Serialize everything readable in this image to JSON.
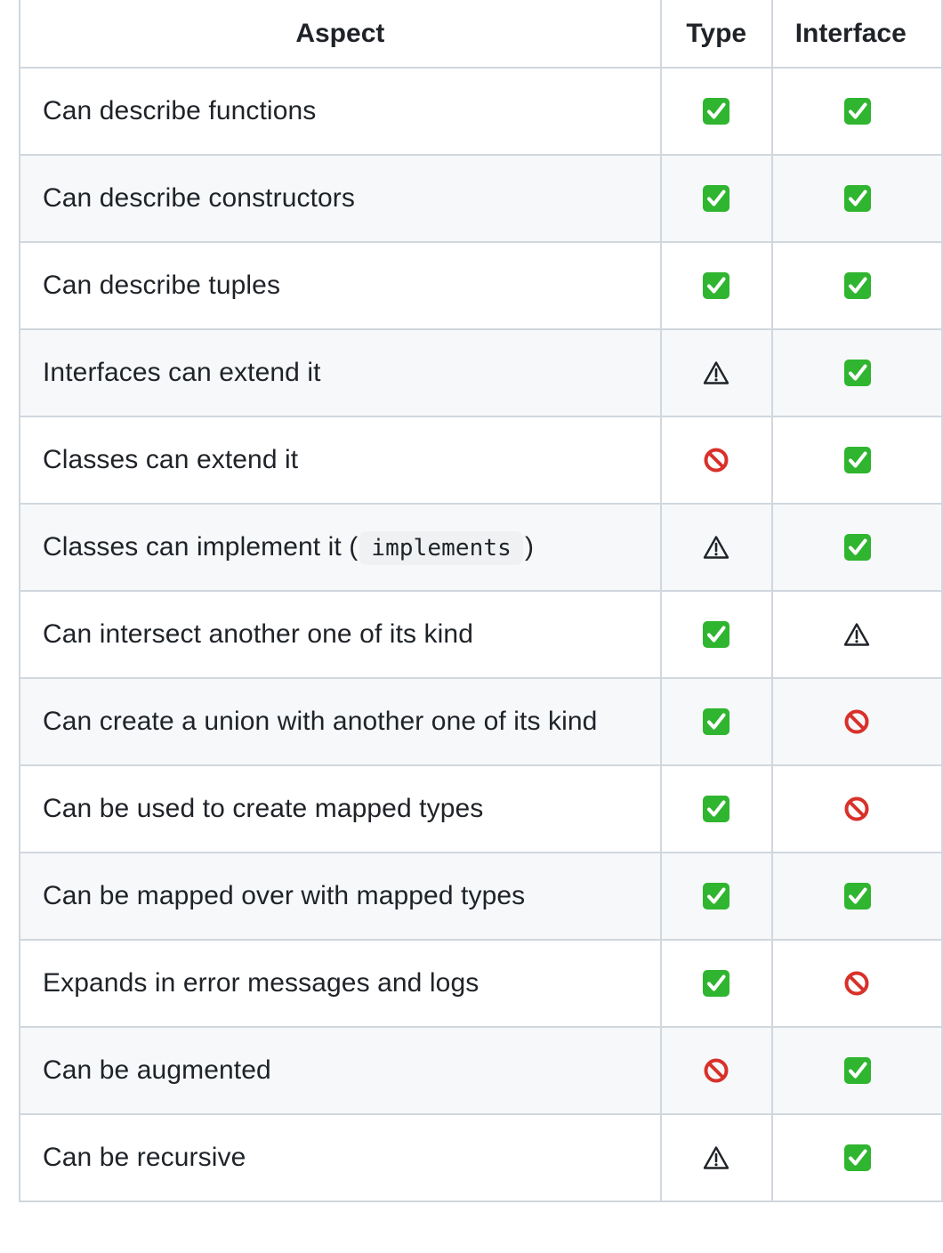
{
  "table": {
    "headers": [
      "Aspect",
      "Type",
      "Interface"
    ],
    "rows": [
      {
        "aspect": "Can describe functions",
        "type": "check",
        "interface": "check"
      },
      {
        "aspect": "Can describe constructors",
        "type": "check",
        "interface": "check"
      },
      {
        "aspect": "Can describe tuples",
        "type": "check",
        "interface": "check"
      },
      {
        "aspect": "Interfaces can extend it",
        "type": "warning",
        "interface": "check"
      },
      {
        "aspect": "Classes can extend it",
        "type": "no-entry",
        "interface": "check"
      },
      {
        "aspect_prefix": "Classes can implement it (",
        "aspect_code": "implements",
        "aspect_suffix": ")",
        "type": "warning",
        "interface": "check"
      },
      {
        "aspect": "Can intersect another one of its kind",
        "type": "check",
        "interface": "warning"
      },
      {
        "aspect": "Can create a union with another one of its kind",
        "type": "check",
        "interface": "no-entry"
      },
      {
        "aspect": "Can be used to create mapped types",
        "type": "check",
        "interface": "no-entry"
      },
      {
        "aspect": "Can be mapped over with mapped types",
        "type": "check",
        "interface": "check"
      },
      {
        "aspect": "Expands in error messages and logs",
        "type": "check",
        "interface": "no-entry"
      },
      {
        "aspect": "Can be augmented",
        "type": "no-entry",
        "interface": "check"
      },
      {
        "aspect": "Can be recursive",
        "type": "warning",
        "interface": "check"
      }
    ]
  },
  "colors": {
    "check_green": "#2fb52f",
    "no_entry_red": "#d8312a",
    "border": "#d0d7de",
    "stripe": "#f6f8fa"
  }
}
